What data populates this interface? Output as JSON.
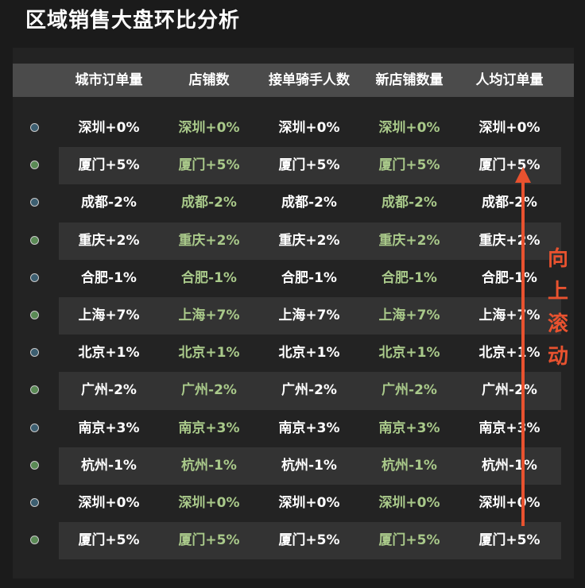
{
  "page": {
    "title": "区域销售大盘环比分析"
  },
  "table": {
    "headers": [
      "城市订单量",
      "店铺数",
      "接单骑手人数",
      "新店铺数量",
      "人均订单量"
    ],
    "rows": [
      {
        "dot": "blue",
        "value": "深圳+0%"
      },
      {
        "dot": "green",
        "value": "厦门+5%"
      },
      {
        "dot": "blue",
        "value": "成都-2%"
      },
      {
        "dot": "green",
        "value": "重庆+2%"
      },
      {
        "dot": "blue",
        "value": "合肥-1%"
      },
      {
        "dot": "green",
        "value": "上海+7%"
      },
      {
        "dot": "blue",
        "value": "北京+1%"
      },
      {
        "dot": "green",
        "value": "广州-2%"
      },
      {
        "dot": "blue",
        "value": "南京+3%"
      },
      {
        "dot": "green",
        "value": "杭州-1%"
      },
      {
        "dot": "blue",
        "value": "深圳+0%"
      },
      {
        "dot": "green",
        "value": "厦门+5%"
      }
    ]
  },
  "annotation": {
    "chars": [
      "向",
      "上",
      "滚",
      "动"
    ],
    "color": "#e8522f"
  },
  "colors": {
    "background": "#1b1b1b",
    "panel": "#232323",
    "header_bg": "#4b4b4b",
    "row_alt": "#333333",
    "text_white": "#ffffff",
    "text_green": "#a9c98a",
    "dot_blue": "#3c5e70",
    "dot_green": "#5a8a55"
  }
}
